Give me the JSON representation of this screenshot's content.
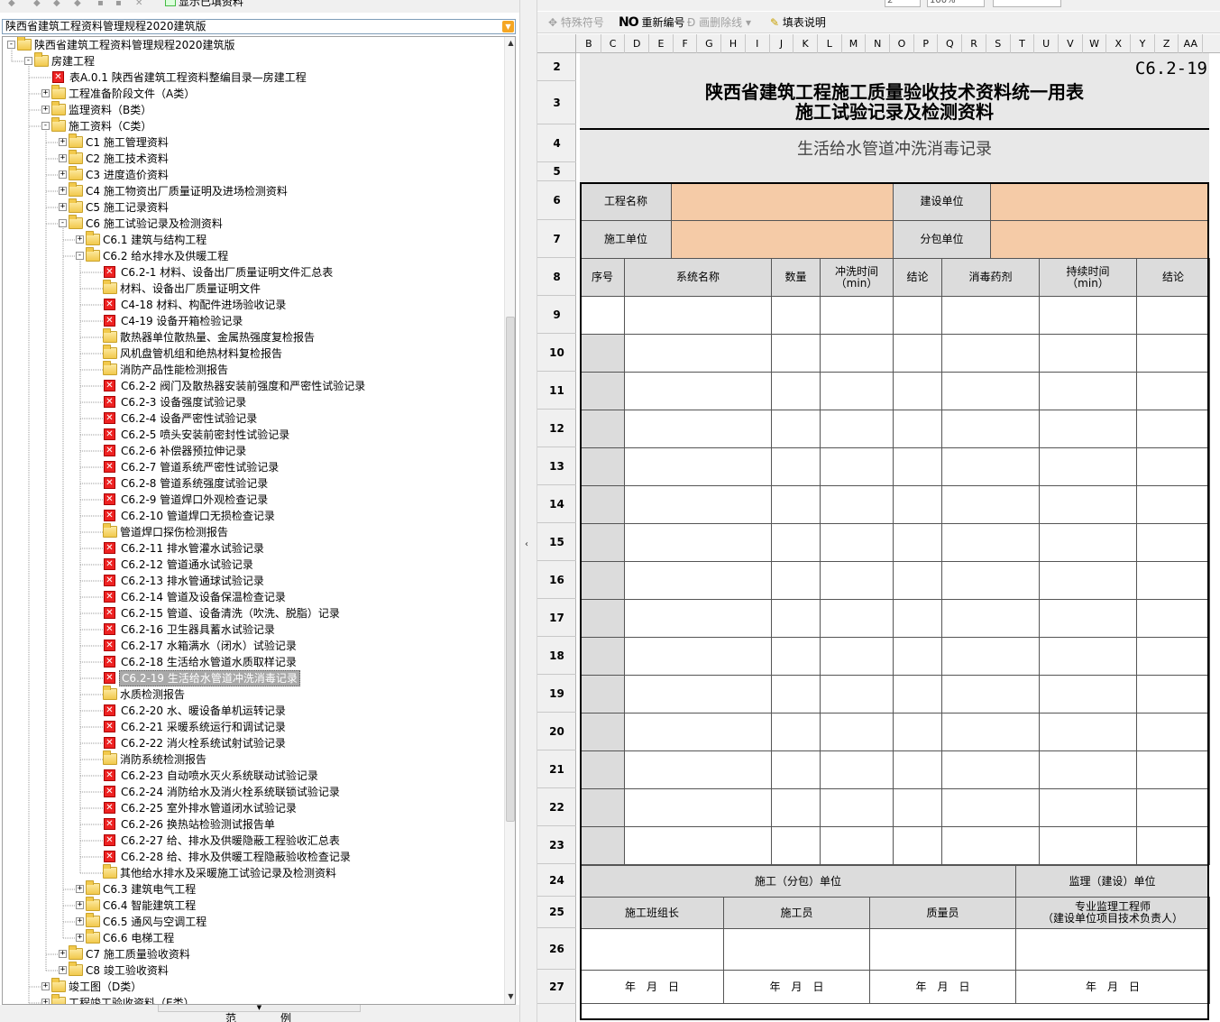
{
  "left_toolbar": {
    "show_filled_label": "显示已填资料"
  },
  "project_select": {
    "value": "陕西省建筑工程资料管理规程2020建筑版"
  },
  "tree": [
    {
      "label": "陕西省建筑工程资料管理规程2020建筑版",
      "depth": 0,
      "kind": "folder",
      "exp": "-"
    },
    {
      "label": "房建工程",
      "depth": 1,
      "kind": "folder",
      "exp": "-"
    },
    {
      "label": "表A.0.1 陕西省建筑工程资料整编目录—房建工程",
      "depth": 2,
      "kind": "form",
      "exp": ""
    },
    {
      "label": "工程准备阶段文件（A类）",
      "depth": 2,
      "kind": "folder",
      "exp": "+"
    },
    {
      "label": "监理资料（B类）",
      "depth": 2,
      "kind": "folder",
      "exp": "+"
    },
    {
      "label": "施工资料（C类）",
      "depth": 2,
      "kind": "folder",
      "exp": "-"
    },
    {
      "label": "C1 施工管理资料",
      "depth": 3,
      "kind": "folder",
      "exp": "+"
    },
    {
      "label": "C2 施工技术资料",
      "depth": 3,
      "kind": "folder",
      "exp": "+"
    },
    {
      "label": "C3 进度造价资料",
      "depth": 3,
      "kind": "folder",
      "exp": "+"
    },
    {
      "label": "C4 施工物资出厂质量证明及进场检测资料",
      "depth": 3,
      "kind": "folder",
      "exp": "+"
    },
    {
      "label": "C5 施工记录资料",
      "depth": 3,
      "kind": "folder",
      "exp": "+"
    },
    {
      "label": "C6 施工试验记录及检测资料",
      "depth": 3,
      "kind": "folder",
      "exp": "-"
    },
    {
      "label": "C6.1 建筑与结构工程",
      "depth": 4,
      "kind": "folder",
      "exp": "+"
    },
    {
      "label": "C6.2 给水排水及供暖工程",
      "depth": 4,
      "kind": "folder",
      "exp": "-"
    },
    {
      "label": "C6.2-1 材料、设备出厂质量证明文件汇总表",
      "depth": 5,
      "kind": "form",
      "exp": ""
    },
    {
      "label": "材料、设备出厂质量证明文件",
      "depth": 5,
      "kind": "folder",
      "exp": ""
    },
    {
      "label": "C4-18 材料、构配件进场验收记录",
      "depth": 5,
      "kind": "form",
      "exp": ""
    },
    {
      "label": "C4-19 设备开箱检验记录",
      "depth": 5,
      "kind": "form",
      "exp": ""
    },
    {
      "label": "散热器单位散热量、金属热强度复检报告",
      "depth": 5,
      "kind": "folder",
      "exp": ""
    },
    {
      "label": "风机盘管机组和绝热材料复检报告",
      "depth": 5,
      "kind": "folder",
      "exp": ""
    },
    {
      "label": "消防产品性能检测报告",
      "depth": 5,
      "kind": "folder",
      "exp": ""
    },
    {
      "label": "C6.2-2 阀门及散热器安装前强度和严密性试验记录",
      "depth": 5,
      "kind": "form",
      "exp": ""
    },
    {
      "label": "C6.2-3 设备强度试验记录",
      "depth": 5,
      "kind": "form",
      "exp": ""
    },
    {
      "label": "C6.2-4 设备严密性试验记录",
      "depth": 5,
      "kind": "form",
      "exp": ""
    },
    {
      "label": "C6.2-5 喷头安装前密封性试验记录",
      "depth": 5,
      "kind": "form",
      "exp": ""
    },
    {
      "label": "C6.2-6 补偿器预拉伸记录",
      "depth": 5,
      "kind": "form",
      "exp": ""
    },
    {
      "label": "C6.2-7 管道系统严密性试验记录",
      "depth": 5,
      "kind": "form",
      "exp": ""
    },
    {
      "label": "C6.2-8 管道系统强度试验记录",
      "depth": 5,
      "kind": "form",
      "exp": ""
    },
    {
      "label": "C6.2-9 管道焊口外观检查记录",
      "depth": 5,
      "kind": "form",
      "exp": ""
    },
    {
      "label": "C6.2-10 管道焊口无损检查记录",
      "depth": 5,
      "kind": "form",
      "exp": ""
    },
    {
      "label": "管道焊口探伤检测报告",
      "depth": 5,
      "kind": "folder",
      "exp": ""
    },
    {
      "label": "C6.2-11 排水管灌水试验记录",
      "depth": 5,
      "kind": "form",
      "exp": ""
    },
    {
      "label": "C6.2-12 管道通水试验记录",
      "depth": 5,
      "kind": "form",
      "exp": ""
    },
    {
      "label": "C6.2-13 排水管通球试验记录",
      "depth": 5,
      "kind": "form",
      "exp": ""
    },
    {
      "label": "C6.2-14 管道及设备保温检查记录",
      "depth": 5,
      "kind": "form",
      "exp": ""
    },
    {
      "label": "C6.2-15 管道、设备清洗（吹洗、脱脂）记录",
      "depth": 5,
      "kind": "form",
      "exp": ""
    },
    {
      "label": "C6.2-16 卫生器具蓄水试验记录",
      "depth": 5,
      "kind": "form",
      "exp": ""
    },
    {
      "label": "C6.2-17 水箱满水（闭水）试验记录",
      "depth": 5,
      "kind": "form",
      "exp": ""
    },
    {
      "label": "C6.2-18 生活给水管道水质取样记录",
      "depth": 5,
      "kind": "form",
      "exp": ""
    },
    {
      "label": "C6.2-19 生活给水管道冲洗消毒记录",
      "depth": 5,
      "kind": "form",
      "exp": "",
      "selected": true
    },
    {
      "label": "水质检测报告",
      "depth": 5,
      "kind": "folder",
      "exp": ""
    },
    {
      "label": "C6.2-20 水、暖设备单机运转记录",
      "depth": 5,
      "kind": "form",
      "exp": ""
    },
    {
      "label": "C6.2-21 采暖系统运行和调试记录",
      "depth": 5,
      "kind": "form",
      "exp": ""
    },
    {
      "label": "C6.2-22 消火栓系统试射试验记录",
      "depth": 5,
      "kind": "form",
      "exp": ""
    },
    {
      "label": "消防系统检测报告",
      "depth": 5,
      "kind": "folder",
      "exp": ""
    },
    {
      "label": "C6.2-23 自动喷水灭火系统联动试验记录",
      "depth": 5,
      "kind": "form",
      "exp": ""
    },
    {
      "label": "C6.2-24 消防给水及消火栓系统联锁试验记录",
      "depth": 5,
      "kind": "form",
      "exp": ""
    },
    {
      "label": "C6.2-25 室外排水管道闭水试验记录",
      "depth": 5,
      "kind": "form",
      "exp": ""
    },
    {
      "label": "C6.2-26 换热站检验测试报告单",
      "depth": 5,
      "kind": "form",
      "exp": ""
    },
    {
      "label": "C6.2-27 给、排水及供暖隐蔽工程验收汇总表",
      "depth": 5,
      "kind": "form",
      "exp": ""
    },
    {
      "label": "C6.2-28 给、排水及供暖工程隐蔽验收检查记录",
      "depth": 5,
      "kind": "form",
      "exp": ""
    },
    {
      "label": "其他给水排水及采暖施工试验记录及检测资料",
      "depth": 5,
      "kind": "folder",
      "exp": ""
    },
    {
      "label": "C6.3 建筑电气工程",
      "depth": 4,
      "kind": "folder",
      "exp": "+"
    },
    {
      "label": "C6.4 智能建筑工程",
      "depth": 4,
      "kind": "folder",
      "exp": "+"
    },
    {
      "label": "C6.5 通风与空调工程",
      "depth": 4,
      "kind": "folder",
      "exp": "+"
    },
    {
      "label": "C6.6 电梯工程",
      "depth": 4,
      "kind": "folder",
      "exp": "+"
    },
    {
      "label": "C7 施工质量验收资料",
      "depth": 3,
      "kind": "folder",
      "exp": "+"
    },
    {
      "label": "C8 竣工验收资料",
      "depth": 3,
      "kind": "folder",
      "exp": "+"
    },
    {
      "label": "竣工图（D类）",
      "depth": 2,
      "kind": "folder",
      "exp": "+"
    },
    {
      "label": "工程竣工验收资料（E类）",
      "depth": 2,
      "kind": "folder",
      "exp": "+"
    }
  ],
  "bottom_tabs": [
    "范",
    "例"
  ],
  "right_toolbar1": {
    "page_value": "2",
    "zoom_value": "100%"
  },
  "right_toolbar2": {
    "special_symbol": "特殊符号",
    "renumber": "重新编号",
    "strike_line": "画删除线",
    "fill_instructions": "填表说明",
    "no_icon": "NO"
  },
  "columns": [
    "B",
    "C",
    "D",
    "E",
    "F",
    "G",
    "H",
    "I",
    "J",
    "K",
    "L",
    "M",
    "N",
    "O",
    "P",
    "Q",
    "R",
    "S",
    "T",
    "U",
    "V",
    "W",
    "X",
    "Y",
    "Z",
    "AA"
  ],
  "rows": [
    "2",
    "3",
    "4",
    "5",
    "6",
    "7",
    "8",
    "9",
    "10",
    "11",
    "12",
    "13",
    "14",
    "15",
    "16",
    "17",
    "18",
    "19",
    "20",
    "21",
    "22",
    "23",
    "24",
    "25",
    "26",
    "27"
  ],
  "form": {
    "code": "C6.2-19",
    "title_line1": "陕西省建筑工程施工质量验收技术资料统一用表",
    "title_line2": "施工试验记录及检测资料",
    "subtitle": "生活给水管道冲洗消毒记录",
    "project_name_label": "工程名称",
    "project_name_value": "",
    "builder_label": "建设单位",
    "builder_value": "",
    "contractor_label": "施工单位",
    "contractor_value": "",
    "subcontractor_label": "分包单位",
    "subcontractor_value": "",
    "table_headers": [
      "序号",
      "系统名称",
      "数量",
      "冲洗时间\n（min）",
      "结论",
      "消毒药剂",
      "持续时间\n（min）",
      "结论"
    ],
    "sign_left_header": "施工（分包）单位",
    "sign_right_header": "监理（建设）单位",
    "sign_roles": [
      "施工班组长",
      "施工员",
      "质量员",
      "专业监理工程师\n（建设单位项目技术负责人）"
    ],
    "date_text": "年　月　日"
  }
}
